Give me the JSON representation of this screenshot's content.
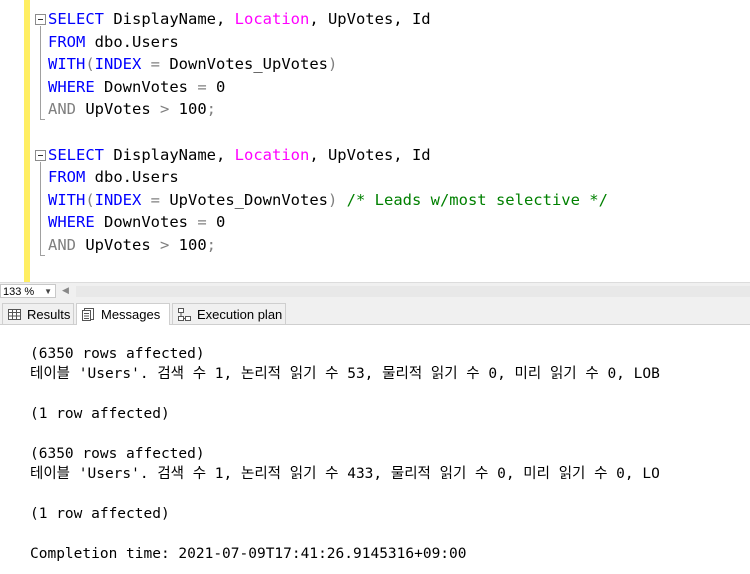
{
  "editor": {
    "query1": {
      "line1": {
        "kw": "SELECT",
        "cols": " DisplayName, ",
        "location": "Location",
        "rest": ", UpVotes, Id"
      },
      "line2": {
        "kw": "FROM",
        "rest": " dbo.Users"
      },
      "line3": {
        "kw": "WITH",
        "paren_open": "(",
        "index_kw": "INDEX",
        "eq": " = ",
        "index_name": "DownVotes_UpVotes",
        "paren_close": ")"
      },
      "line4": {
        "kw": "WHERE",
        "rest": " DownVotes ",
        "eq": "=",
        "val": " 0"
      },
      "line5": {
        "kw": "AND",
        "rest": " UpVotes ",
        "gt": ">",
        "val": " 100",
        "semi": ";"
      }
    },
    "query2": {
      "line1": {
        "kw": "SELECT",
        "cols": " DisplayName, ",
        "location": "Location",
        "rest": ", UpVotes, Id"
      },
      "line2": {
        "kw": "FROM",
        "rest": " dbo.Users"
      },
      "line3": {
        "kw": "WITH",
        "paren_open": "(",
        "index_kw": "INDEX",
        "eq": " = ",
        "index_name": "UpVotes_DownVotes",
        "paren_close": ")",
        "comment": " /* Leads w/most selective */"
      },
      "line4": {
        "kw": "WHERE",
        "rest": " DownVotes ",
        "eq": "=",
        "val": " 0"
      },
      "line5": {
        "kw": "AND",
        "rest": " UpVotes ",
        "gt": ">",
        "val": " 100",
        "semi": ";"
      }
    }
  },
  "statusbar": {
    "zoom": "133 %"
  },
  "tabs": [
    {
      "label": "Results",
      "icon": "grid-icon"
    },
    {
      "label": "Messages",
      "icon": "messages-icon"
    },
    {
      "label": "Execution plan",
      "icon": "execution-plan-icon"
    }
  ],
  "messages": [
    "(6350 rows affected)",
    "테이블 'Users'. 검색 수 1, 논리적 읽기 수 53, 물리적 읽기 수 0, 미리 읽기 수 0, LOB",
    "(1 row affected)",
    "(6350 rows affected)",
    "테이블 'Users'. 검색 수 1, 논리적 읽기 수 433, 물리적 읽기 수 0, 미리 읽기 수 0, LO",
    "(1 row affected)",
    "Completion time: 2021-07-09T17:41:26.9145316+09:00"
  ],
  "colors": {
    "keyword": "#0000ff",
    "function": "#ff00ff",
    "operator": "#808080",
    "comment": "#008000",
    "change_bar": "#ffee62"
  }
}
